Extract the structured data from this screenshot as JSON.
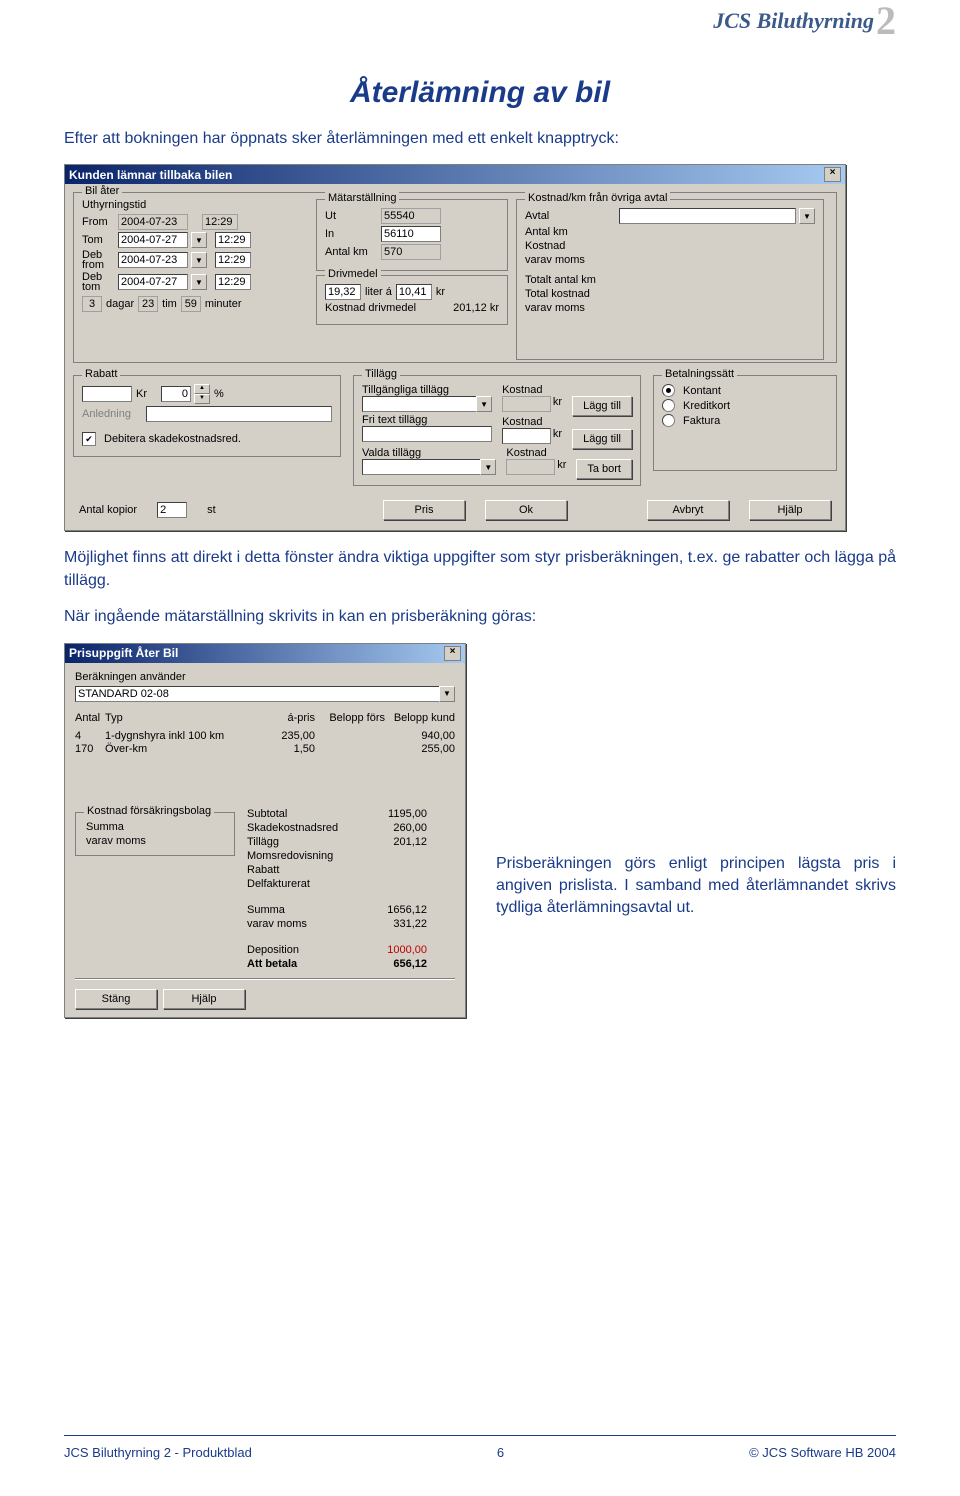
{
  "logo_text": "JCS Biluthyrning",
  "logo_num": "2",
  "page_title": "Återlämning av bil",
  "intro_text": "Efter att bokningen har öppnats sker återlämningen med ett enkelt knapptryck:",
  "para2": "Möjlighet finns att direkt i detta fönster ändra viktiga uppgifter som styr prisberäkningen, t.ex. ge rabatter och lägga på tillägg.",
  "para3": "När ingående mätarställning skrivits in kan en prisberäkning göras:",
  "side_text": "Prisberäkningen görs enligt principen lägsta pris i angiven prislista. I samband med återlämnandet skrivs tydliga återlämningsavtal ut.",
  "dlg1": {
    "title": "Kunden lämnar tillbaka bilen",
    "bil_ater": "Bil åter",
    "uthyrningstid": "Uthyrningstid",
    "from_lbl": "From",
    "from_date": "2004-07-23",
    "from_time": "12:29",
    "tom_lbl": "Tom",
    "tom_date": "2004-07-27",
    "tom_time": "12:29",
    "debfrom_lbl1": "Deb",
    "debfrom_lbl2": "from",
    "debfrom_date": "2004-07-23",
    "debfrom_time": "12:29",
    "debtom_lbl1": "Deb",
    "debtom_lbl2": "tom",
    "debtom_date": "2004-07-27",
    "debtom_time": "12:29",
    "dur_days": "3",
    "dagar": "dagar",
    "dur_hrs": "23",
    "tim": "tim",
    "dur_min": "59",
    "minuter": "minuter",
    "matar_lbl": "Mätarställning",
    "ut_lbl": "Ut",
    "ut_val": "55540",
    "in_lbl": "In",
    "in_val": "56110",
    "antalkm_lbl": "Antal km",
    "antalkm_val": "570",
    "driv_lbl": "Drivmedel",
    "liter_val": "19,32",
    "liter_a": "liter á",
    "pris_l": "10,41",
    "kr": "kr",
    "kostdriv_lbl": "Kostnad drivmedel",
    "kostdriv_val": "201,12 kr",
    "kmavtal_lbl": "Kostnad/km från övriga avtal",
    "avtal_lbl": "Avtal",
    "antalkm2_lbl": "Antal km",
    "kostnad_lbl": "Kostnad",
    "varav_lbl": "varav moms",
    "totkm_lbl": "Totalt antal km",
    "totkost_lbl": "Total kostnad",
    "varav2_lbl": "varav moms",
    "rabatt_lbl": "Rabatt",
    "kr2": "Kr",
    "noll": "0",
    "pct": "%",
    "anledning_lbl": "Anledning",
    "debskade_lbl": "Debitera skadekostnadsred.",
    "debskade_check": "✔",
    "tillagg_lbl": "Tillägg",
    "tillg_lbl": "Tillgängliga tillägg",
    "fritxt_lbl": "Fri text tillägg",
    "valda_lbl": "Valda tillägg",
    "kostnad2": "Kostnad",
    "laggtill": "Lägg till",
    "tabort": "Ta bort",
    "betal_lbl": "Betalningssätt",
    "b_kontant": "Kontant",
    "b_kredit": "Kreditkort",
    "b_faktura": "Faktura",
    "antal_kopior_lbl": "Antal kopior",
    "antal_kopior_val": "2",
    "st": "st",
    "pris_btn": "Pris",
    "ok_btn": "Ok",
    "avbryt_btn": "Avbryt",
    "hjalp_btn": "Hjälp"
  },
  "dlg2": {
    "title": "Prisuppgift Åter Bil",
    "ber_lbl": "Beräkningen använder",
    "ber_val": "STANDARD 02-08",
    "h_antal": "Antal",
    "h_typ": "Typ",
    "h_apris": "á-pris",
    "h_bf": "Belopp förs",
    "h_bk": "Belopp kund",
    "r1_a": "4",
    "r1_t": "1-dygnshyra inkl 100 km",
    "r1_p": "235,00",
    "r1_k": "940,00",
    "r2_a": "170",
    "r2_t": "Över-km",
    "r2_p": "1,50",
    "r2_k": "255,00",
    "ins_lbl": "Kostnad försäkringsbolag",
    "summa_lbl": "Summa",
    "varav_lbl": "varav moms",
    "sub_lbl": "Subtotal",
    "sub_v": "1195,00",
    "sk_lbl": "Skadekostnadsred",
    "sk_v": "260,00",
    "til_lbl": "Tillägg",
    "til_v": "201,12",
    "moms_lbl": "Momsredovisning",
    "rab_lbl": "Rabatt",
    "delf_lbl": "Delfakturerat",
    "summa2_lbl": "Summa",
    "summa2_v": "1656,12",
    "varav2_lbl": "varav moms",
    "varav2_v": "331,22",
    "dep_lbl": "Deposition",
    "dep_v": "1000,00",
    "att_lbl": "Att betala",
    "att_v": "656,12",
    "stang": "Stäng",
    "hjalp": "Hjälp"
  },
  "footer": {
    "left": "JCS Biluthyrning 2  -  Produktblad",
    "center": "6",
    "right": "© JCS Software HB 2004"
  }
}
